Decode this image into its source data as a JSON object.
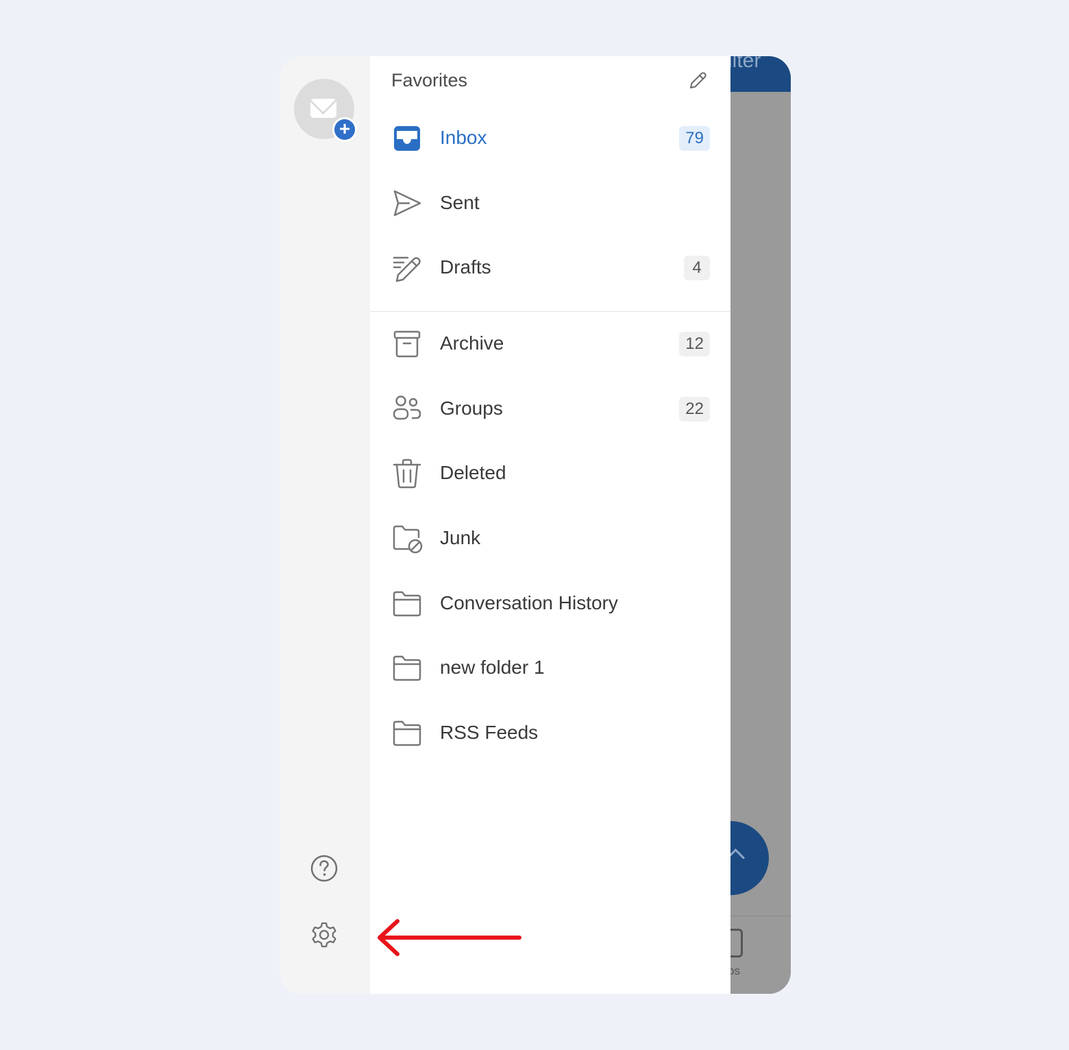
{
  "background_app": {
    "header_fragment": "ilter",
    "tab_label_fragment": "ps"
  },
  "rail": {
    "account_button": "add-account",
    "help_icon": "help-icon",
    "settings_icon": "gear-icon"
  },
  "favorites": {
    "title": "Favorites",
    "edit_icon": "pencil-icon",
    "items": [
      {
        "label": "Inbox",
        "count": "79",
        "icon": "inbox-icon",
        "active": true
      },
      {
        "label": "Sent",
        "count": "",
        "icon": "send-icon",
        "active": false
      },
      {
        "label": "Drafts",
        "count": "4",
        "icon": "drafts-icon",
        "active": false
      }
    ]
  },
  "folders": {
    "items": [
      {
        "label": "Archive",
        "count": "12",
        "icon": "archive-icon"
      },
      {
        "label": "Groups",
        "count": "22",
        "icon": "groups-icon"
      },
      {
        "label": "Deleted",
        "count": "",
        "icon": "trash-icon"
      },
      {
        "label": "Junk",
        "count": "",
        "icon": "junk-folder-icon"
      },
      {
        "label": "Conversation History",
        "count": "",
        "icon": "folder-icon"
      },
      {
        "label": "new folder 1",
        "count": "",
        "icon": "folder-icon"
      },
      {
        "label": "RSS Feeds",
        "count": "",
        "icon": "folder-icon"
      }
    ]
  },
  "colors": {
    "accent": "#2a6ec4",
    "header_blue": "#1b4a82",
    "annotation_arrow": "#e8141b"
  }
}
